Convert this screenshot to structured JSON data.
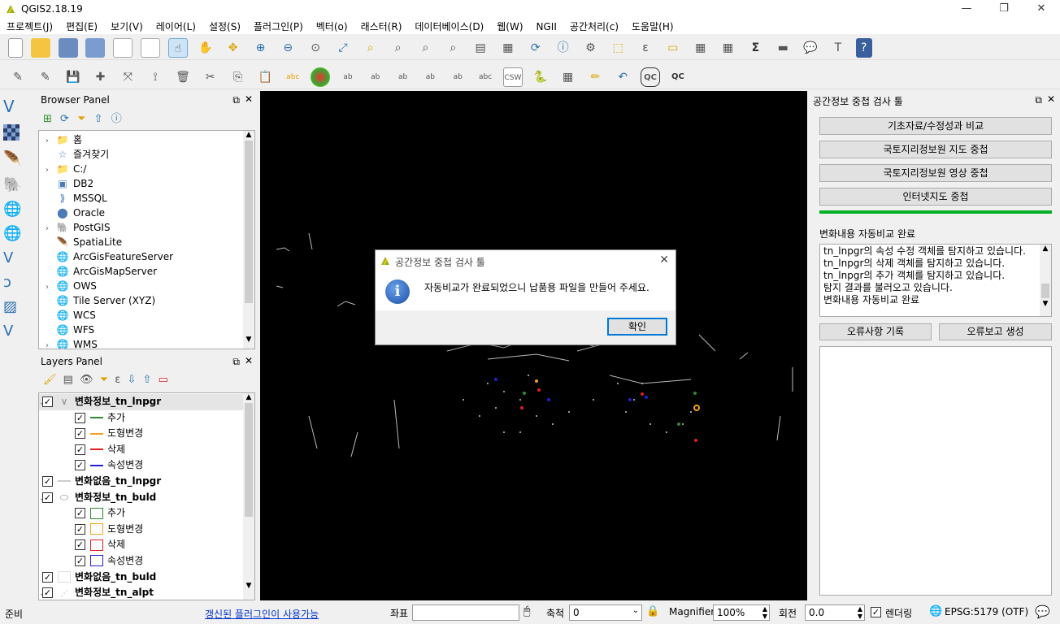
{
  "window": {
    "title": "QGIS2.18.19"
  },
  "menu": [
    "프로젝트(J)",
    "편집(E)",
    "보기(V)",
    "레이어(L)",
    "설정(S)",
    "플러그인(P)",
    "벡터(o)",
    "래스터(R)",
    "데이터베이스(D)",
    "웹(W)",
    "NGII",
    "공간처리(c)",
    "도움말(H)"
  ],
  "browser": {
    "title": "Browser Panel",
    "items": [
      {
        "label": "홈",
        "icon": "folder-icon",
        "expand": true
      },
      {
        "label": "즐겨찾기",
        "icon": "star-icon",
        "expand": false
      },
      {
        "label": "C:/",
        "icon": "folder-icon",
        "expand": true
      },
      {
        "label": "DB2",
        "icon": "db2-icon",
        "expand": false
      },
      {
        "label": "MSSQL",
        "icon": "mssql-icon",
        "expand": false
      },
      {
        "label": "Oracle",
        "icon": "oracle-icon",
        "expand": false
      },
      {
        "label": "PostGIS",
        "icon": "postgis-icon",
        "expand": true
      },
      {
        "label": "SpatiaLite",
        "icon": "spatialite-icon",
        "expand": false
      },
      {
        "label": "ArcGisFeatureServer",
        "icon": "arcgis-icon",
        "expand": false
      },
      {
        "label": "ArcGisMapServer",
        "icon": "arcgis-icon",
        "expand": false
      },
      {
        "label": "OWS",
        "icon": "globe-icon",
        "expand": true
      },
      {
        "label": "Tile Server (XYZ)",
        "icon": "globe-icon",
        "expand": false
      },
      {
        "label": "WCS",
        "icon": "globe-icon",
        "expand": false
      },
      {
        "label": "WFS",
        "icon": "globe-icon",
        "expand": false
      },
      {
        "label": "WMS",
        "icon": "globe-icon",
        "expand": true
      }
    ]
  },
  "layers": {
    "title": "Layers Panel",
    "items": [
      {
        "label": "변화정보_tn_lnpgr",
        "level": 0,
        "bold": true,
        "expand": "v",
        "sym": "line-icon",
        "selected": true
      },
      {
        "label": "추가",
        "level": 1,
        "sym": "line",
        "color": "#2e8b2e"
      },
      {
        "label": "도형변경",
        "level": 1,
        "sym": "line",
        "color": "#f0a020"
      },
      {
        "label": "삭제",
        "level": 1,
        "sym": "line",
        "color": "#e02020"
      },
      {
        "label": "속성변경",
        "level": 1,
        "sym": "line",
        "color": "#2020d0"
      },
      {
        "label": "변화없음_tn_lnpgr",
        "level": 0,
        "bold": true,
        "expand": "",
        "sym": "line",
        "color": "#cccccc"
      },
      {
        "label": "변화정보_tn_buld",
        "level": 0,
        "bold": true,
        "expand": "v",
        "sym": "polygon-icon"
      },
      {
        "label": "추가",
        "level": 1,
        "sym": "box",
        "color": "#2e8b2e"
      },
      {
        "label": "도형변경",
        "level": 1,
        "sym": "box",
        "color": "#f0a020"
      },
      {
        "label": "삭제",
        "level": 1,
        "sym": "box",
        "color": "#e02020"
      },
      {
        "label": "속성변경",
        "level": 1,
        "sym": "box",
        "color": "#2020d0"
      },
      {
        "label": "변화없음_tn_buld",
        "level": 0,
        "bold": true,
        "expand": "",
        "sym": "box",
        "color": "#dddddd"
      },
      {
        "label": "변화정보_tn_alpt",
        "level": 0,
        "bold": true,
        "expand": "v",
        "sym": "point-icon"
      }
    ]
  },
  "right_panel": {
    "title": "공간정보 중첩 검사 툴",
    "buttons": [
      "기초자료/수정성과 비교",
      "국토지리정보원 지도 중첩",
      "국토지리정보원 영상 중첩",
      "인터넷지도 중첩"
    ],
    "progress": 1.0,
    "status_label": "변화내용 자동비교 완료",
    "log": [
      "tn_lnpgr의 속성 수정 객체를 탐지하고 있습니다.",
      "tn_lnpgr의 삭제 객체를 탐지하고 있습니다.",
      "tn_lnpgr의 추가 객체를 탐지하고 있습니다.",
      "탐지 결과를 불러오고 있습니다.",
      "변화내용 자동비교 완료"
    ],
    "btn_error_record": "오류사항 기록",
    "btn_error_report": "오류보고 생성"
  },
  "dialog": {
    "title": "공간정보 중첩 검사 툴",
    "message": "자동비교가 완료되었으니 납품용 파일을 만들어 주세요.",
    "ok": "확인"
  },
  "status": {
    "ready": "준비",
    "plugin_link": "갱신된 플러그인이 사용가능",
    "coord_label": "좌표",
    "coord_value": "",
    "scale_label": "축척",
    "scale_value": "0",
    "magnifier_label": "Magnifier",
    "magnifier_value": "100%",
    "rotation_label": "회전",
    "rotation_value": "0.0",
    "render_label": "렌더링",
    "crs": "EPSG:5179 (OTF)"
  },
  "colors": {
    "accent": "#0078d7",
    "progress": "#06b025",
    "map_bg": "#000000"
  }
}
